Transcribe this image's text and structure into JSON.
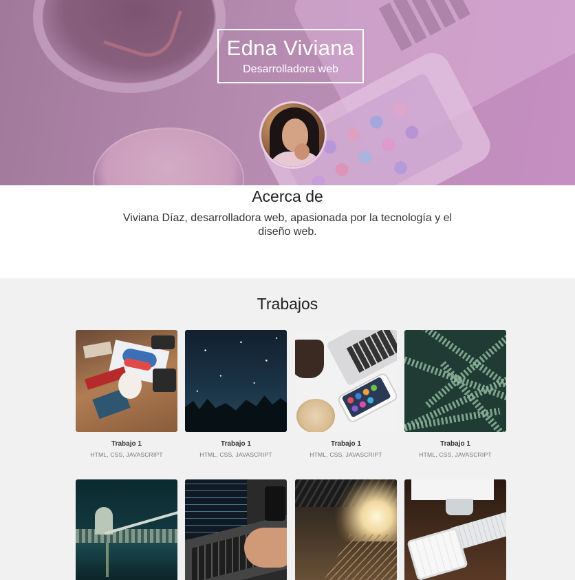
{
  "header": {
    "name": "Edna Viviana",
    "role": "Desarrolladora web"
  },
  "about": {
    "title": "Acerca de",
    "text": "Viviana Díaz, desarrolladora web, apasionada por la tecnología y el diseño web."
  },
  "works": {
    "title": "Trabajos",
    "items": [
      {
        "title": "Trabajo 1",
        "subtitle": "HTML, CSS, JAVASCRIPT"
      },
      {
        "title": "Trabajo 1",
        "subtitle": "HTML, CSS, JAVASCRIPT"
      },
      {
        "title": "Trabajo 1",
        "subtitle": "HTML, CSS, JAVASCRIPT"
      },
      {
        "title": "Trabajo 1",
        "subtitle": "HTML, CSS, JAVASCRIPT"
      }
    ]
  },
  "colors": {
    "hero_overlay": "#c894c4",
    "works_background": "#f1f1f1"
  }
}
